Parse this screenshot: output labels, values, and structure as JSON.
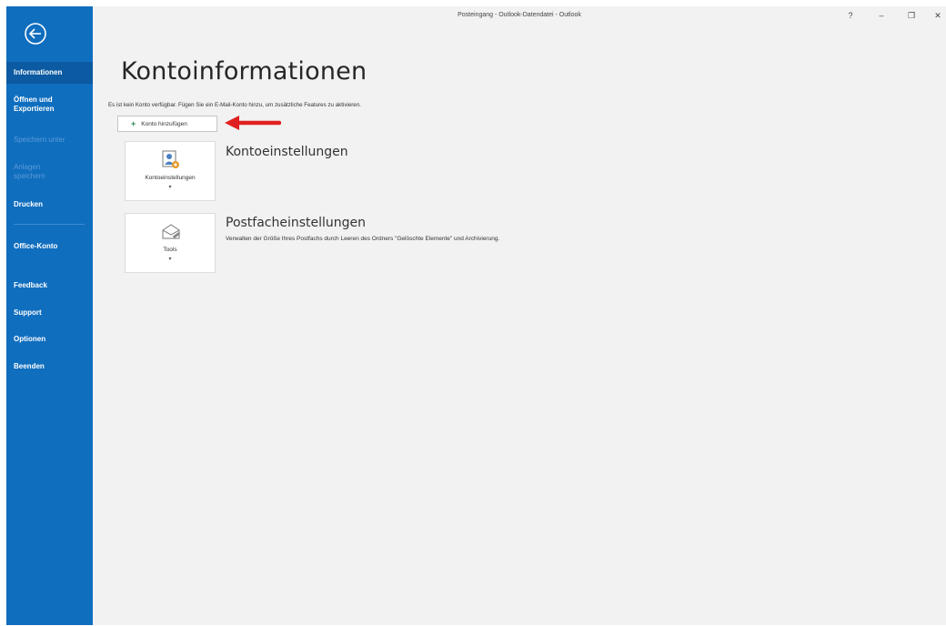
{
  "window": {
    "title": "Posteingang - Outlook-Datendatei  -  Outlook",
    "help": "?",
    "minimize": "–",
    "restore": "❐",
    "close": "✕"
  },
  "sidebar": {
    "back_icon": "back-arrow-icon",
    "items": [
      {
        "label": "Informationen",
        "active": true,
        "enabled": true
      },
      {
        "label": "Öffnen und Exportieren",
        "active": false,
        "enabled": true
      },
      {
        "label": "Speichern unter",
        "active": false,
        "enabled": false
      },
      {
        "label": "Anlagen speichern",
        "active": false,
        "enabled": false
      },
      {
        "label": "Drucken",
        "active": false,
        "enabled": true
      },
      {
        "label": "Office-Konto",
        "active": false,
        "enabled": true
      },
      {
        "label": "Feedback",
        "active": false,
        "enabled": true
      },
      {
        "label": "Support",
        "active": false,
        "enabled": true
      },
      {
        "label": "Optionen",
        "active": false,
        "enabled": true
      },
      {
        "label": "Beenden",
        "active": false,
        "enabled": true
      }
    ]
  },
  "main": {
    "page_title": "Kontoinformationen",
    "info_text": "Es ist kein Konto verfügbar. Fügen Sie ein E-Mail-Konto hinzu, um zusätzliche Features zu aktivieren.",
    "add_account_label": "Konto hinzufügen",
    "sections": [
      {
        "tile_label": "Kontoeinstellungen",
        "tile_caret": "▾",
        "heading": "Kontoeinstellungen",
        "description": "",
        "icon": "account-settings-icon"
      },
      {
        "tile_label": "Tools",
        "tile_caret": "▾",
        "heading": "Postfacheinstellungen",
        "description": "Verwalten der Größe Ihres Postfachs durch Leeren des Ordners \"Gelöschte Elemente\" und Archivierung.",
        "icon": "tools-icon"
      }
    ]
  },
  "colors": {
    "sidebar": "#106ebe",
    "sidebar_active": "#0b5aa2",
    "arrow": "#e02020",
    "background": "#f2f2f2"
  }
}
